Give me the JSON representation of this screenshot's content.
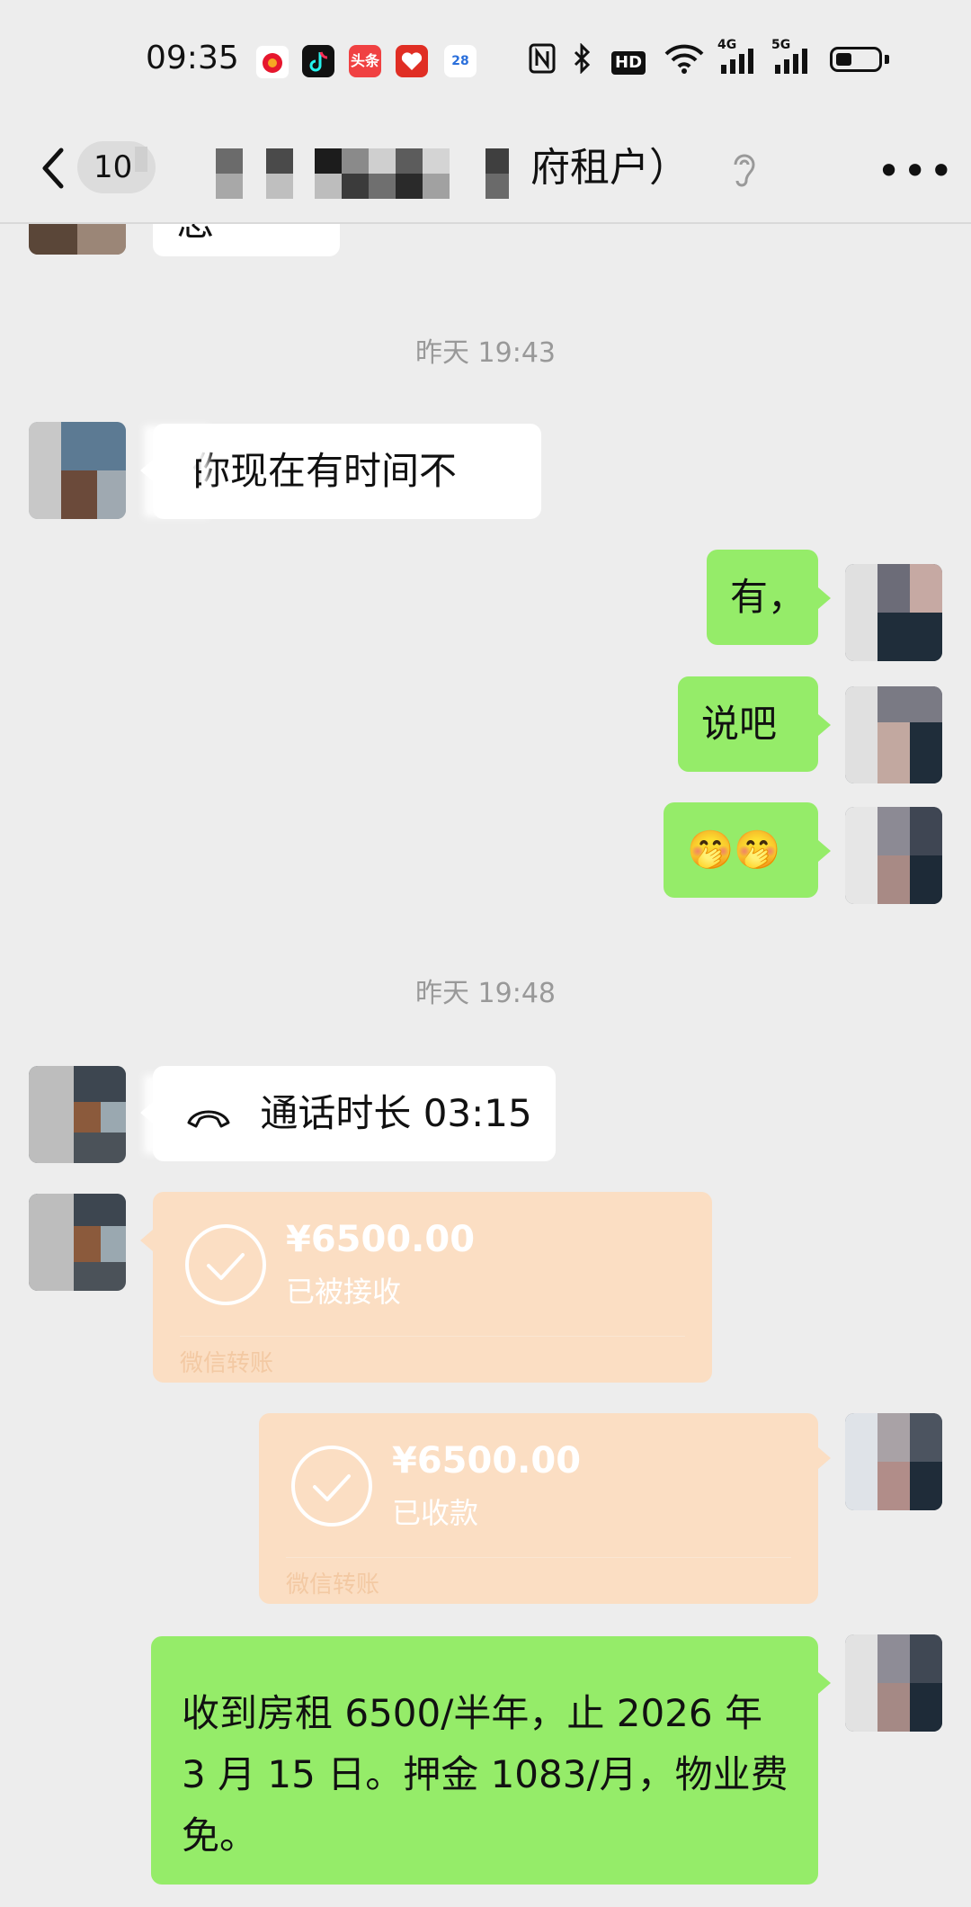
{
  "status_bar": {
    "time": "09:35",
    "app_icons": [
      "weibo-icon",
      "tiktok-icon",
      "toutiao-icon",
      "pinduoduo-icon",
      "calendar-icon"
    ],
    "toutiao_label": "头条",
    "calendar_day": "28",
    "system_icons": [
      "nfc-icon",
      "bluetooth-icon",
      "hd-icon",
      "wifi-icon",
      "signal-4g-icon",
      "signal-5g-icon",
      "battery-icon"
    ],
    "hd_label": "HD",
    "net_4g": "4G",
    "net_5g": "5G"
  },
  "nav": {
    "unread_count": "10",
    "title_visible": "府租户）",
    "icons": [
      "back-icon",
      "ear-icon",
      "more-icon"
    ]
  },
  "chat": {
    "top_partial_text": "怎",
    "timestamps": [
      "昨天 19:43",
      "昨天 19:48"
    ],
    "messages": [
      {
        "side": "in",
        "text": "你现在有时间不",
        "prefix_fragment": "白"
      },
      {
        "side": "out",
        "text": "有，"
      },
      {
        "side": "out",
        "text": "说吧"
      },
      {
        "side": "out",
        "text": "🤭🤭"
      },
      {
        "side": "in",
        "type": "call",
        "text": "通话时长 03:15"
      },
      {
        "side": "in",
        "type": "transfer",
        "amount": "¥6500.00",
        "status": "已被接收",
        "footer": "微信转账"
      },
      {
        "side": "out",
        "type": "transfer",
        "amount": "¥6500.00",
        "status": "已收款",
        "footer": "微信转账"
      },
      {
        "side": "out",
        "text": "收到房租 6500/半年，止 2026 年 3 月 15 日。押金 1083/月，物业费免。"
      }
    ]
  },
  "colors": {
    "background": "#ededed",
    "outgoing_bubble": "#95ec69",
    "incoming_bubble": "#ffffff",
    "transfer_card": "#fbdec3",
    "timestamp": "#999999"
  }
}
